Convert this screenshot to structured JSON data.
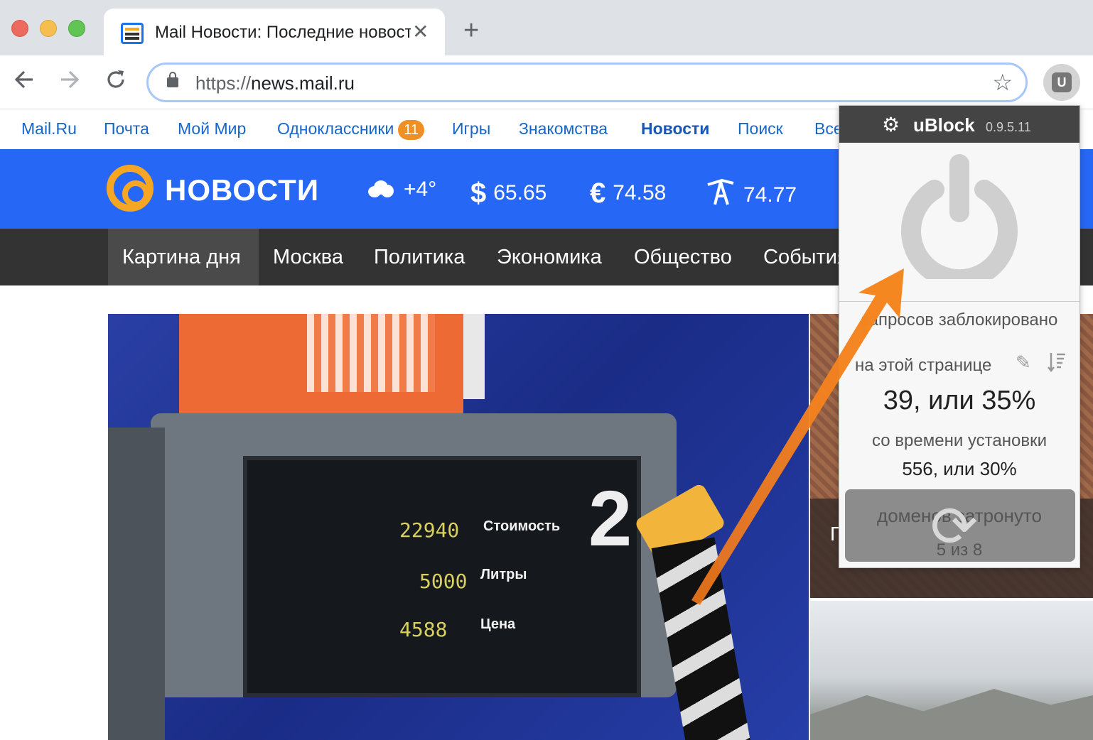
{
  "browser": {
    "tab_title": "Mail Новости: Последние новости",
    "tab_close": "✕",
    "new_tab": "+",
    "url_scheme": "https://",
    "url_host": "news.mail.ru",
    "extension_letter": "U"
  },
  "portal": {
    "links": [
      "Mail.Ru",
      "Почта",
      "Мой Мир",
      "Одноклассники",
      "Игры",
      "Знакомства",
      "Новости",
      "Поиск",
      "Все"
    ],
    "badge": "11"
  },
  "header": {
    "logo": "НОВОСТИ",
    "weather": "+4°",
    "usd_symbol": "$",
    "usd": "65.65",
    "eur_symbol": "€",
    "eur": "74.58",
    "oil": "74.77"
  },
  "categories": [
    "Картина дня",
    "Москва",
    "Политика",
    "Экономика",
    "Общество",
    "События"
  ],
  "hero": {
    "digits": [
      "22940",
      "5000",
      "4588"
    ],
    "labels": [
      "Стоимость",
      "Литры",
      "Цена"
    ],
    "pump_number": "2"
  },
  "side_text": "Г",
  "ublock": {
    "title": "uBlock",
    "version": "0.9.5.11",
    "blocked_label": "запросов заблокировано",
    "on_page_label": "на этой странице",
    "on_page_value": "39, или 35%",
    "since_install_label": "со времени установки",
    "since_install_value": "556, или 30%",
    "domains_label": "доменов затронуто",
    "domains_value": "5 из 8"
  },
  "colors": {
    "brand_blue": "#2767f5",
    "accent_orange": "#f5a623",
    "arrow_orange": "#f57d1f",
    "nav_dark": "#333333"
  }
}
